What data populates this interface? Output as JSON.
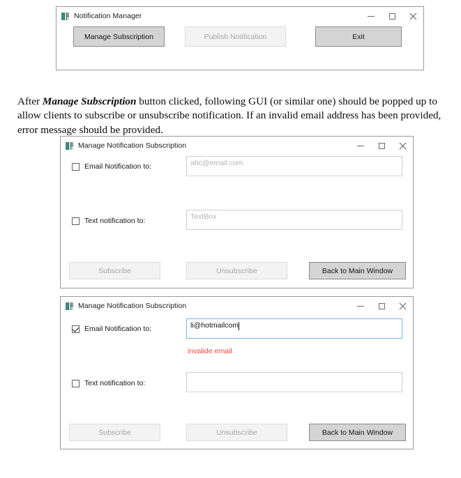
{
  "document": {
    "paragraph_prefix": "After ",
    "paragraph_emphasis": "Manage Subscription",
    "paragraph_rest": " button clicked, following GUI (or similar one) should be popped up to allow clients to subscribe or unsubscribe notification. If an invalid email address has been provided, error message should be provided."
  },
  "colors": {
    "error_text": "#fa4135",
    "focus_border": "#7eb4e2",
    "button_face": "#d4d4d4",
    "button_disabled_face": "#f3f3f3",
    "placeholder_text": "#b3b3b3"
  },
  "window_main": {
    "title": "Notification Manager",
    "icon": "app-icon",
    "chrome": {
      "minimize": "minimize-icon",
      "maximize": "maximize-icon",
      "close": "close-icon"
    },
    "buttons": [
      {
        "label": "Manage Subscription",
        "enabled": true
      },
      {
        "label": "Publish Notification",
        "enabled": false
      },
      {
        "label": "Exit",
        "enabled": true
      }
    ]
  },
  "window_subscription_empty": {
    "title": "Manage Notification Subscription",
    "email_row": {
      "label": "Email Notification to:",
      "checked": false,
      "value": "",
      "placeholder": "abc@email.com",
      "focused": false
    },
    "text_row": {
      "label": "Text notification to:",
      "checked": false,
      "value": "",
      "placeholder": "TextBox",
      "focused": false
    },
    "error": "",
    "buttons": [
      {
        "label": "Subscribe",
        "enabled": false
      },
      {
        "label": "Unsubscribe",
        "enabled": false
      },
      {
        "label": "Back to Main Window",
        "enabled": true
      }
    ]
  },
  "window_subscription_error": {
    "title": "Manage Notification Subscription",
    "email_row": {
      "label": "Email Notification to:",
      "checked": true,
      "value": "li@hotmailcom",
      "placeholder": "",
      "focused": true
    },
    "text_row": {
      "label": "Text notification to:",
      "checked": false,
      "value": "",
      "placeholder": "",
      "focused": false
    },
    "error": "invalide email",
    "buttons": [
      {
        "label": "Subscribe",
        "enabled": false
      },
      {
        "label": "Unsubscribe",
        "enabled": false
      },
      {
        "label": "Back to Main Window",
        "enabled": true
      }
    ]
  }
}
